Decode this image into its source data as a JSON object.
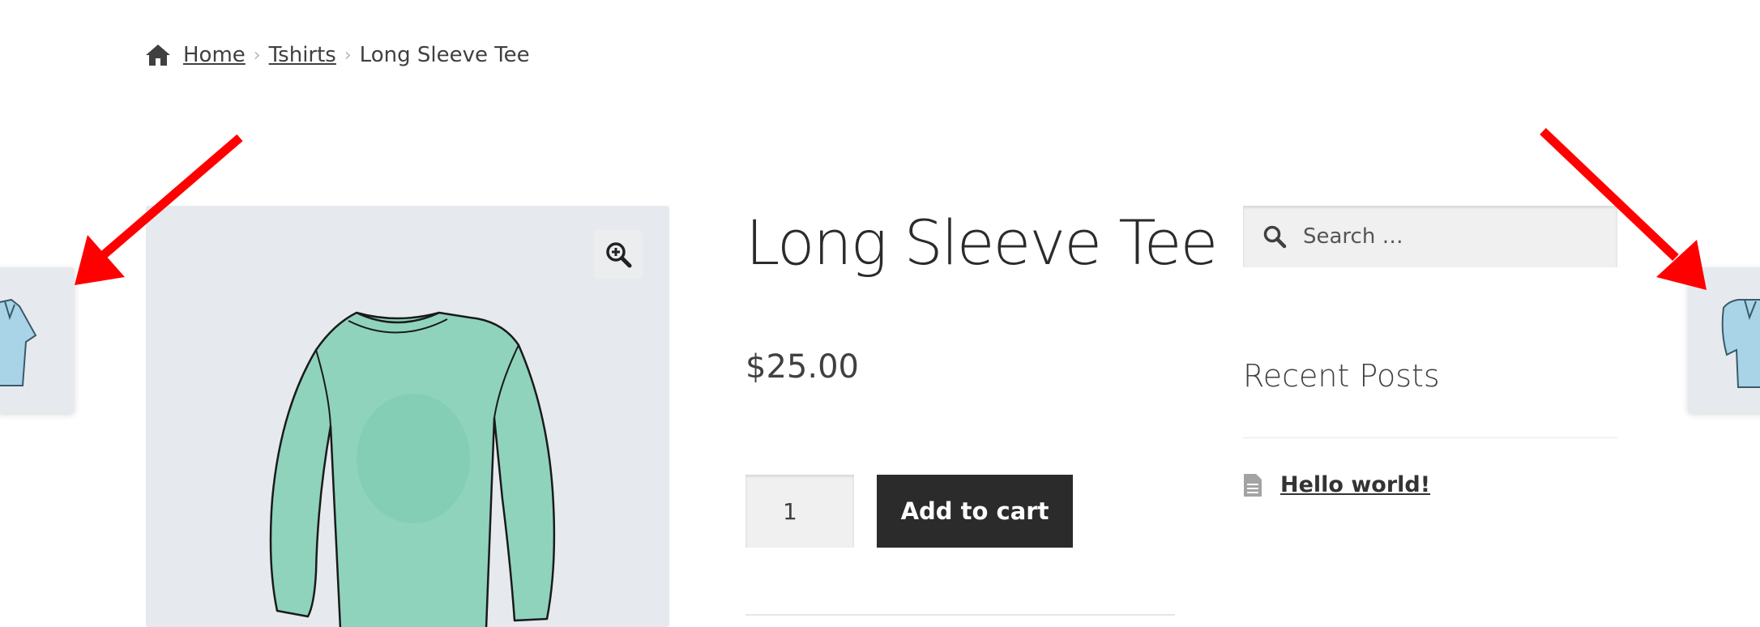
{
  "breadcrumb": {
    "home_icon": "home-icon",
    "items": [
      "Home",
      "Tshirts",
      "Long Sleeve Tee"
    ]
  },
  "product": {
    "title": "Long Sleeve Tee",
    "price": "$25.00",
    "quantity": "1",
    "add_to_cart_label": "Add to cart",
    "zoom_icon": "zoom-in-icon",
    "image_color": "#8fd3bd"
  },
  "sidebar": {
    "search_placeholder": "Search …",
    "recent_posts_title": "Recent Posts",
    "posts": [
      "Hello world!"
    ]
  },
  "navigation": {
    "prev_thumbnail": "polo-shirt-thumbnail",
    "next_thumbnail": "polo-shirt-thumbnail"
  },
  "annotation": {
    "arrow_color": "#ff0000"
  }
}
